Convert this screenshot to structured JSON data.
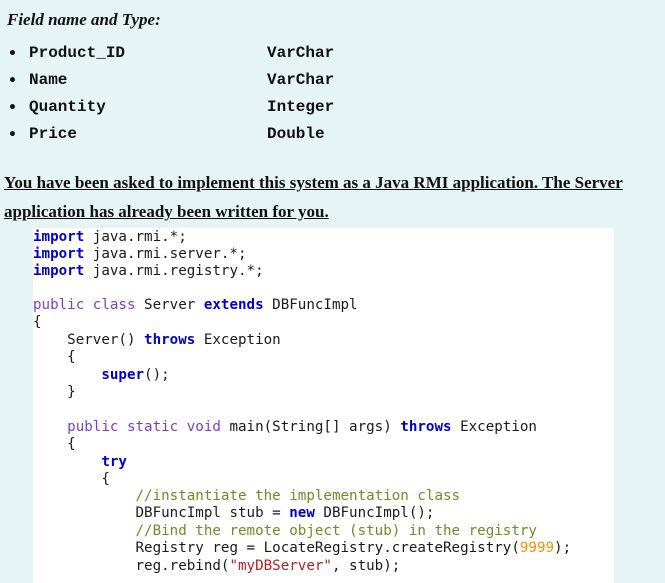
{
  "heading": "Field name and Type:",
  "fields": [
    {
      "name": "Product_ID",
      "type": "VarChar"
    },
    {
      "name": "Name",
      "type": "VarChar"
    },
    {
      "name": "Quantity",
      "type": "Integer"
    },
    {
      "name": "Price",
      "type": "Double"
    }
  ],
  "instruction": "You have been asked to implement this system as a Java RMI application. The Server application has already been written for you.",
  "code": {
    "import1_kw": "import",
    "import1_rest": " java.rmi.*;",
    "import2_kw": "import",
    "import2_rest": " java.rmi.server.*;",
    "import3_kw": "import",
    "import3_rest": " java.rmi.registry.*;",
    "class_decl": "public class",
    "class_name": " Server ",
    "extends_kw": "extends",
    "parent_class": " DBFuncImpl",
    "open_brace": "{",
    "ctor_name": "    Server() ",
    "throws1_kw": "throws",
    "exception1": " Exception",
    "brace2": "    {",
    "super_kw": "        super",
    "super_rest": "();",
    "brace3": "    }",
    "main_mods": "    public static void",
    "main_sig": " main(String[] args) ",
    "throws2_kw": "throws",
    "exception2": " Exception",
    "brace4": "    {",
    "try_kw": "        try",
    "brace5": "        {",
    "comment1": "            //instantiate the implementation class",
    "stub_decl": "            DBFuncImpl stub = ",
    "new_kw": "new",
    "stub_rest": " DBFuncImpl();",
    "comment2": "            //Bind the remote object (stub) in the registry",
    "reg_decl": "            Registry reg = LocateRegistry.createRegistry(",
    "port": "9999",
    "reg_end": ");",
    "rebind_start": "            reg.rebind(",
    "rebind_name": "\"myDBServer\"",
    "rebind_end": ", stub);"
  }
}
